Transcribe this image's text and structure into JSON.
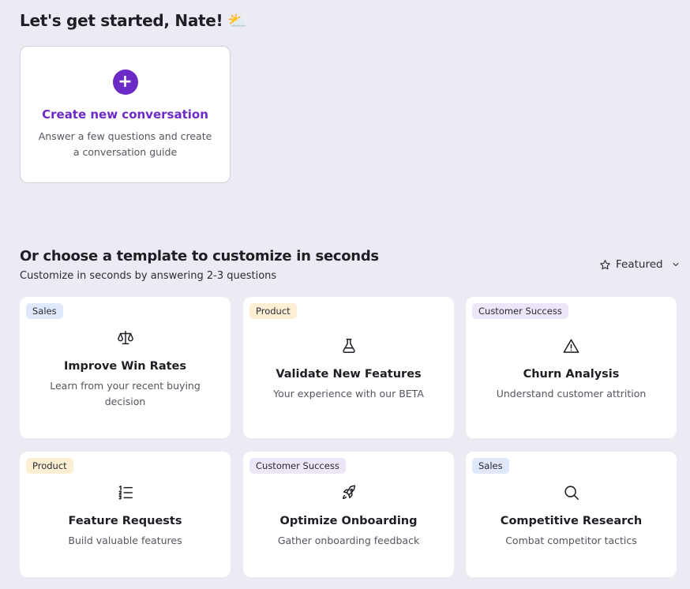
{
  "header": {
    "greeting": "Let's get started, Nate!",
    "greeting_emoji": "⛅"
  },
  "create": {
    "title": "Create new conversation",
    "description": "Answer a few questions and create a conversation guide",
    "icon": "plus-icon"
  },
  "templates_section": {
    "title": "Or choose a template to customize in seconds",
    "subtitle": "Customize in seconds by answering 2-3 questions",
    "sort_label": "Featured"
  },
  "templates": [
    {
      "tag": "Sales",
      "title": "Improve Win Rates",
      "description": "Learn from your recent buying decision",
      "icon": "scale-icon"
    },
    {
      "tag": "Product",
      "title": "Validate New Features",
      "description": "Your experience with our BETA",
      "icon": "flask-icon"
    },
    {
      "tag": "Customer Success",
      "title": "Churn Analysis",
      "description": "Understand customer attrition",
      "icon": "warning-icon"
    },
    {
      "tag": "Product",
      "title": "Feature Requests",
      "description": "Build valuable features",
      "icon": "list-icon"
    },
    {
      "tag": "Customer Success",
      "title": "Optimize Onboarding",
      "description": "Gather onboarding feedback",
      "icon": "rocket-icon"
    },
    {
      "tag": "Sales",
      "title": "Competitive Research",
      "description": "Combat competitor tactics",
      "icon": "search-icon"
    }
  ],
  "colors": {
    "accent": "#6c2bc7",
    "background": "#ebecf3",
    "tag_sales": "#dfe9fb",
    "tag_product": "#fdefd3",
    "tag_customer_success": "#ece6f8"
  }
}
